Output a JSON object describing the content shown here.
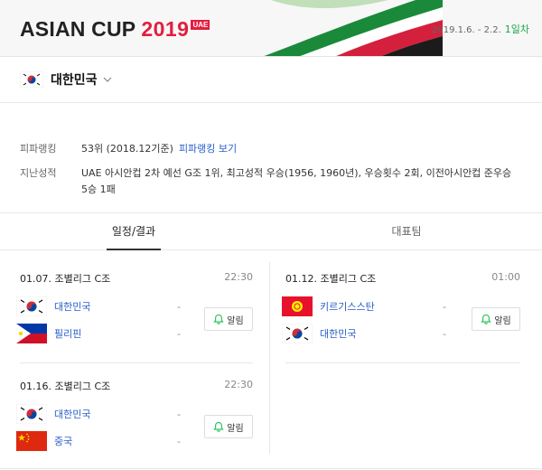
{
  "header": {
    "logo_main": "ASIAN CUP",
    "logo_year": "2019",
    "logo_badge": "UAE",
    "period": "2019.1.6. - 2.2.",
    "day_label": "1일차"
  },
  "team": {
    "name": "대한민국",
    "flag_icon": "korea-flag-icon"
  },
  "info": {
    "fifa_label": "피파랭킹",
    "fifa_value": "53위 (2018.12기준)",
    "fifa_link": "피파랭킹 보기",
    "history_label": "지난성적",
    "history_value": "UAE 아시안컵 2차 예선 G조 1위, 최고성적 우승(1956, 1960년), 우승횟수 2회, 이전아시안컵 준우승 5승 1패"
  },
  "tabs": [
    {
      "label": "일정/결과",
      "active": true
    },
    {
      "label": "대표팀",
      "active": false
    }
  ],
  "matches": [
    {
      "date": "01.07.",
      "group": "조별리그 C조",
      "time": "22:30",
      "home": {
        "name": "대한민국",
        "flag": "korea-flag-icon",
        "score": "-"
      },
      "away": {
        "name": "필리핀",
        "flag": "philippines-flag-icon",
        "score": "-"
      },
      "alarm": "알림"
    },
    {
      "date": "01.12.",
      "group": "조별리그 C조",
      "time": "01:00",
      "home": {
        "name": "키르기스스탄",
        "flag": "kyrgyzstan-flag-icon",
        "score": "-"
      },
      "away": {
        "name": "대한민국",
        "flag": "korea-flag-icon",
        "score": "-"
      },
      "alarm": "알림"
    },
    {
      "date": "01.16.",
      "group": "조별리그 C조",
      "time": "22:30",
      "home": {
        "name": "대한민국",
        "flag": "korea-flag-icon",
        "score": "-"
      },
      "away": {
        "name": "중국",
        "flag": "china-flag-icon",
        "score": "-"
      },
      "alarm": "알림"
    }
  ],
  "colors": {
    "accent_red": "#e31d3f",
    "link_blue": "#2a5ec8",
    "day_green": "#1aa84b",
    "alarm_green": "#2ec462"
  }
}
